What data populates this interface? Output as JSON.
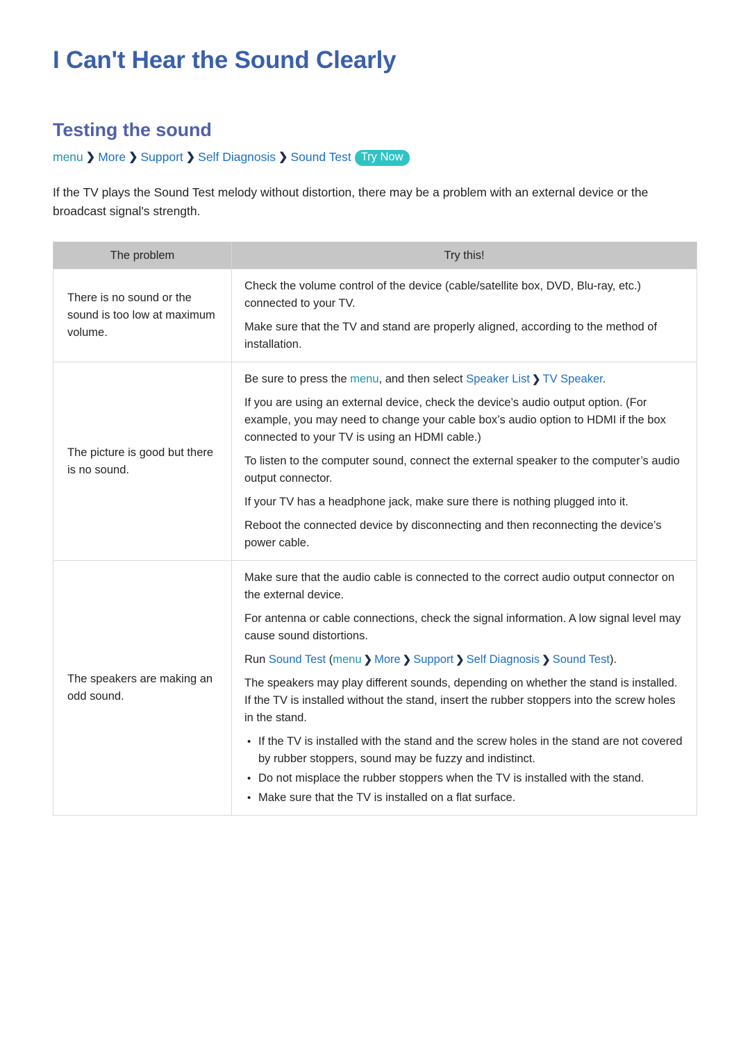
{
  "document": {
    "title": "I Can't Hear the Sound Clearly",
    "section_title": "Testing the sound"
  },
  "breadcrumb": {
    "menu": "menu",
    "separator": "❯",
    "items": [
      "More",
      "Support",
      "Self Diagnosis",
      "Sound Test"
    ],
    "badge": "Try Now"
  },
  "intro": "If the TV plays the Sound Test melody without distortion, there may be a problem with an external device or the broadcast signal's strength.",
  "table": {
    "headers": {
      "problem": "The problem",
      "try_this": "Try this!"
    },
    "rows": [
      {
        "problem": "There is no sound or the sound is too low at maximum volume.",
        "paragraphs": [
          "Check the volume control of the device (cable/satellite box, DVD, Blu-ray, etc.) connected to your TV.",
          "Make sure that the TV and stand are properly aligned, according to the method of installation."
        ]
      },
      {
        "problem": "The picture is good but there is no sound.",
        "para_1_pre": "Be sure to press the ",
        "para_1_menu": "menu",
        "para_1_mid": ", and then select ",
        "para_1_link1": "Speaker List",
        "para_1_sep": "❯",
        "para_1_link2": "TV Speaker",
        "para_1_post": ".",
        "paragraphs": [
          "If you are using an external device, check the device’s audio output option. (For example, you may need to change your cable box’s audio option to HDMI if the box connected to your TV is using an HDMI cable.)",
          "To listen to the computer sound, connect the external speaker to the computer’s audio output connector.",
          "If your TV has a headphone jack, make sure there is nothing plugged into it.",
          "Reboot the connected device by disconnecting and then reconnecting the device’s power cable."
        ]
      },
      {
        "problem": "The speakers are making an odd sound.",
        "paragraphs_before": [
          "Make sure that the audio cable is connected to the correct audio output connector on the external device.",
          "For antenna or cable connections, check the signal information. A low signal level may cause sound distortions."
        ],
        "run_line": {
          "run": "Run ",
          "sound_test": "Sound Test",
          "open_paren": " (",
          "menu": "menu",
          "separator": "❯",
          "path": [
            "More",
            "Support",
            "Self Diagnosis",
            "Sound Test"
          ],
          "close_paren": ")."
        },
        "paragraphs_after": [
          "The speakers may play different sounds, depending on whether the stand is installed. If the TV is installed without the stand, insert the rubber stoppers into the screw holes in the stand."
        ],
        "bullets": [
          "If the TV is installed with the stand and the screw holes in the stand are not covered by rubber stoppers, sound may be fuzzy and indistinct.",
          "Do not misplace the rubber stoppers when the TV is installed with the stand.",
          "Make sure that the TV is installed on a flat surface."
        ]
      }
    ]
  }
}
